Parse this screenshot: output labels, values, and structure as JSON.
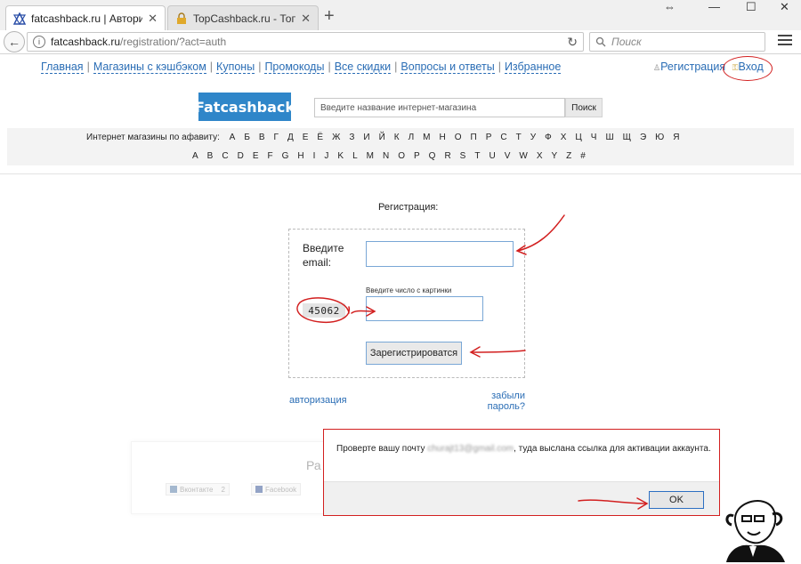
{
  "browser": {
    "tabs": [
      {
        "title": "fatcashback.ru | Авториза…",
        "active": true
      },
      {
        "title": "TopCashback.ru - Топ лу…",
        "active": false
      }
    ],
    "new_tab": "+",
    "url_host": "fatcashback.ru",
    "url_path": "/registration/?act=auth",
    "search_placeholder": "Поиск",
    "window_controls": [
      "⇔",
      "—",
      "☐",
      "✕"
    ]
  },
  "site": {
    "nav": [
      "Главная",
      "Магазины с кэшбэком",
      "Купоны",
      "Промокоды",
      "Все скидки",
      "Вопросы и ответы",
      "Избранное"
    ],
    "register_link": "Регистрация",
    "login_link": "Вход",
    "logo": "Fatcashback",
    "shop_search_placeholder": "Введите название интернет-магазина",
    "shop_search_button": "Поиск",
    "alphabet_label": "Интернет магазины по афавиту:",
    "cyrillic": [
      "А",
      "Б",
      "В",
      "Г",
      "Д",
      "Е",
      "Ё",
      "Ж",
      "З",
      "И",
      "Й",
      "К",
      "Л",
      "М",
      "Н",
      "О",
      "П",
      "Р",
      "С",
      "Т",
      "У",
      "Ф",
      "Х",
      "Ц",
      "Ч",
      "Ш",
      "Щ",
      "Э",
      "Ю",
      "Я"
    ],
    "latin": [
      "A",
      "B",
      "C",
      "D",
      "E",
      "F",
      "G",
      "H",
      "I",
      "J",
      "K",
      "L",
      "M",
      "N",
      "O",
      "P",
      "Q",
      "R",
      "S",
      "T",
      "U",
      "V",
      "W",
      "X",
      "Y",
      "Z",
      "#"
    ]
  },
  "registration": {
    "title": "Регистрация:",
    "email_label": "Введите email:",
    "email_value": "",
    "captcha_hint": "Введите число с картинки",
    "captcha_code": "45062",
    "captcha_value": "",
    "submit": "Зарегистрироватся",
    "auth_link": "авторизация",
    "forgot_link": "забыли пароль?"
  },
  "social": {
    "heading_fragment": "Ра",
    "vk": "Вконтакте",
    "vk_count": "2",
    "fb": "Facebook"
  },
  "dialog": {
    "message_before": "Проверте вашу почту ",
    "message_email": "churajt13@gmail.com",
    "message_after": ", туда выслана ссылка для активации аккаунта.",
    "ok": "OK"
  },
  "colors": {
    "accent": "#2a6db5",
    "logo_bg": "#2f86c9",
    "annotation": "#d21f1f"
  }
}
